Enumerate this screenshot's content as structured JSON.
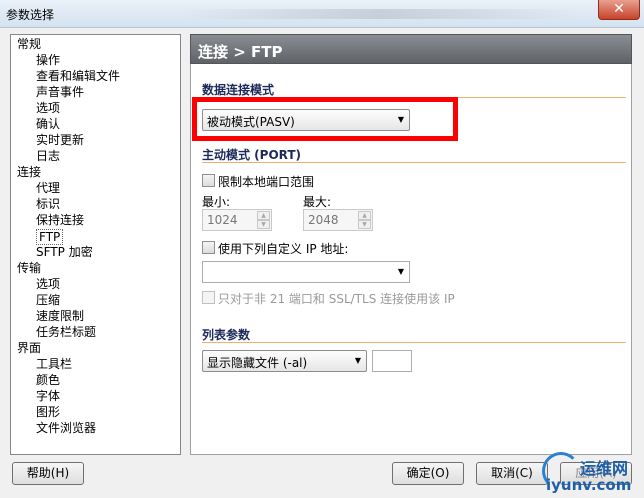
{
  "window": {
    "title": "参数选择",
    "close_glyph": "✕"
  },
  "tree": {
    "items": [
      {
        "label": "常规",
        "level": 0
      },
      {
        "label": "操作",
        "level": 1
      },
      {
        "label": "查看和编辑文件",
        "level": 1
      },
      {
        "label": "声音事件",
        "level": 1
      },
      {
        "label": "选项",
        "level": 1
      },
      {
        "label": "确认",
        "level": 1
      },
      {
        "label": "实时更新",
        "level": 1
      },
      {
        "label": "日志",
        "level": 1
      },
      {
        "label": "连接",
        "level": 0
      },
      {
        "label": "代理",
        "level": 1
      },
      {
        "label": "标识",
        "level": 1
      },
      {
        "label": "保持连接",
        "level": 1
      },
      {
        "label": "FTP",
        "level": 1,
        "selected": true
      },
      {
        "label": "SFTP 加密",
        "level": 1
      },
      {
        "label": "传输",
        "level": 0
      },
      {
        "label": "选项",
        "level": 1
      },
      {
        "label": "压缩",
        "level": 1
      },
      {
        "label": "速度限制",
        "level": 1
      },
      {
        "label": "任务栏标题",
        "level": 1
      },
      {
        "label": "界面",
        "level": 0
      },
      {
        "label": "工具栏",
        "level": 1
      },
      {
        "label": "颜色",
        "level": 1
      },
      {
        "label": "字体",
        "level": 1
      },
      {
        "label": "图形",
        "level": 1
      },
      {
        "label": "文件浏览器",
        "level": 1
      }
    ]
  },
  "panel": {
    "header": "连接 > FTP",
    "data_mode": {
      "title": "数据连接模式",
      "selected": "被动模式(PASV)"
    },
    "active_mode": {
      "title": "主动模式 (PORT)",
      "limit_range_label": "限制本地端口范围",
      "min_label": "最小:",
      "min_value": "1024",
      "max_label": "最大:",
      "max_value": "2048",
      "custom_ip_label": "使用下列自定义 IP 地址:",
      "custom_ip_value": "",
      "only_non21_label": "只对于非 21 端口和 SSL/TLS 连接使用该 IP"
    },
    "list_params": {
      "title": "列表参数",
      "selected": "显示隐藏文件 (-al)",
      "extra_value": ""
    }
  },
  "buttons": {
    "help": "帮助(H)",
    "ok": "确定(O)",
    "cancel": "取消(C)",
    "apply": "应用(A)"
  },
  "watermark": {
    "line1": "运维网",
    "line2": "iyunv.com"
  },
  "colors": {
    "highlight_box": "#ff0000",
    "section_title": "#1c2a5a",
    "section_rule": "#f0b070"
  }
}
